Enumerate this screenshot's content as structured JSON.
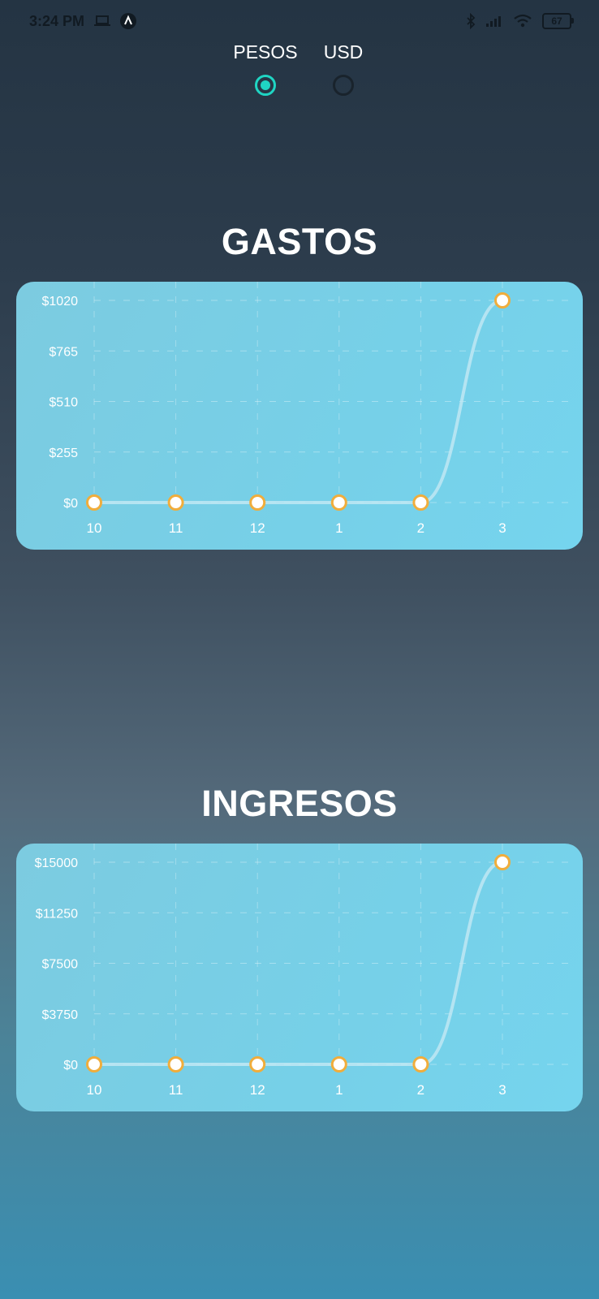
{
  "status_bar": {
    "time": "3:24 PM",
    "battery": "67",
    "icons": [
      "laptop-icon",
      "app-a-icon",
      "bluetooth-icon",
      "signal-icon",
      "wifi-icon",
      "battery-icon"
    ]
  },
  "currency_selector": {
    "options": [
      {
        "label": "PESOS",
        "selected": true
      },
      {
        "label": "USD",
        "selected": false
      }
    ],
    "accent_color": "#1fd5c3"
  },
  "gastos": {
    "title": "GASTOS"
  },
  "ingresos": {
    "title": "INGRESOS"
  },
  "colors": {
    "card": "#76d0e8",
    "point_border": "#f0ad3c",
    "point_fill": "#ffffff",
    "line": "#bfe7f3"
  },
  "chart_data": [
    {
      "type": "line",
      "title": "GASTOS",
      "categories": [
        "10",
        "11",
        "12",
        "1",
        "2",
        "3"
      ],
      "y_tick_labels": [
        "$0",
        "$255",
        "$510",
        "$765",
        "$1020"
      ],
      "ylim": [
        0,
        1020
      ],
      "series": [
        {
          "values": [
            0,
            0,
            0,
            0,
            0,
            1020
          ]
        }
      ],
      "grid": true,
      "curve": "smooth"
    },
    {
      "type": "line",
      "title": "INGRESOS",
      "categories": [
        "10",
        "11",
        "12",
        "1",
        "2",
        "3"
      ],
      "y_tick_labels": [
        "$0",
        "$3750",
        "$7500",
        "$11250",
        "$15000"
      ],
      "ylim": [
        0,
        15000
      ],
      "series": [
        {
          "values": [
            0,
            0,
            0,
            0,
            0,
            15000
          ]
        }
      ],
      "grid": true,
      "curve": "smooth"
    }
  ]
}
